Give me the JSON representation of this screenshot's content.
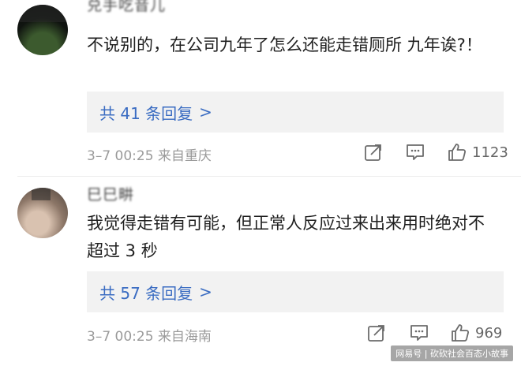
{
  "comments": [
    {
      "username": "兑手吃音儿",
      "content": "不说别的，在公司九年了怎么还能走错厕所 九年诶?！",
      "replies_label": "共 41 条回复",
      "replies_chevron": ">",
      "time_location": "3–7 00:25 来自重庆",
      "likes": "1123"
    },
    {
      "username": "巳巳畊",
      "content": "我觉得走错有可能，但正常人反应过来出来用时绝对不超过 3 秒",
      "replies_label": "共 57 条回复",
      "replies_chevron": ">",
      "time_location": "3–7 00:25 来自海南",
      "likes": "969"
    }
  ],
  "watermark": "网易号 | 砍砍社会百态小故事",
  "icons": [
    "share-icon",
    "comment-icon",
    "like-icon"
  ],
  "colors": {
    "link": "#3a6cc2",
    "meta": "#9a9a9a",
    "reply_bg": "#f2f2f2"
  }
}
